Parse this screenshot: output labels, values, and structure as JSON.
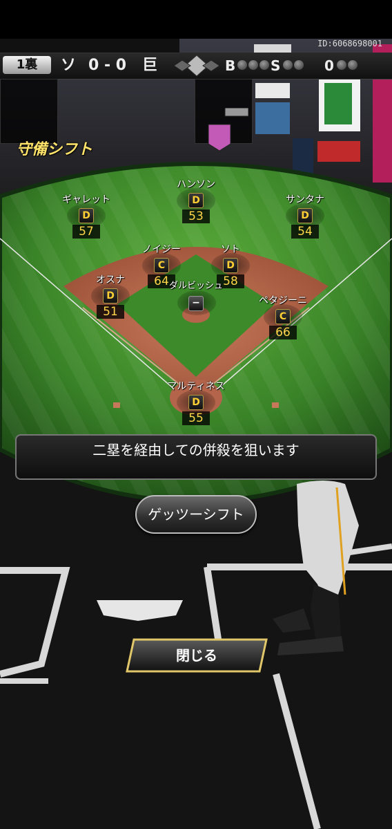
{
  "scoreboard": {
    "inning": "1裏",
    "away_team": "ソ",
    "score": "0 - 0",
    "home_team": "巨",
    "balls_label": "B",
    "strikes_label": "S",
    "outs_value": "0",
    "user_id": "ID:6068698001"
  },
  "title": "守備シフト",
  "fielders": [
    {
      "key": "lf",
      "name": "ギャレット",
      "grade": "D",
      "value": "57"
    },
    {
      "key": "cf",
      "name": "ハンソン",
      "grade": "D",
      "value": "53"
    },
    {
      "key": "rf",
      "name": "サンタナ",
      "grade": "D",
      "value": "54"
    },
    {
      "key": "ss",
      "name": "ノイジー",
      "grade": "C",
      "value": "64"
    },
    {
      "key": "2b",
      "name": "ソト",
      "grade": "D",
      "value": "58"
    },
    {
      "key": "3b",
      "name": "オスナ",
      "grade": "D",
      "value": "51"
    },
    {
      "key": "1b",
      "name": "ペタジーニ",
      "grade": "C",
      "value": "66"
    },
    {
      "key": "c",
      "name": "マルティネス",
      "grade": "D",
      "value": "55"
    }
  ],
  "pitcher": {
    "name": "ダルビッシュ",
    "badge": "−"
  },
  "message": "二塁を経由しての併殺を狙います",
  "shift_button": "ゲッツーシフト",
  "close_button": "閉じる",
  "colors": {
    "grade_text": "#ffcf33",
    "value_text": "#ffd64a",
    "title": "#ffe36a",
    "grass": "#3f8a2c",
    "dirt": "#b5694a"
  }
}
